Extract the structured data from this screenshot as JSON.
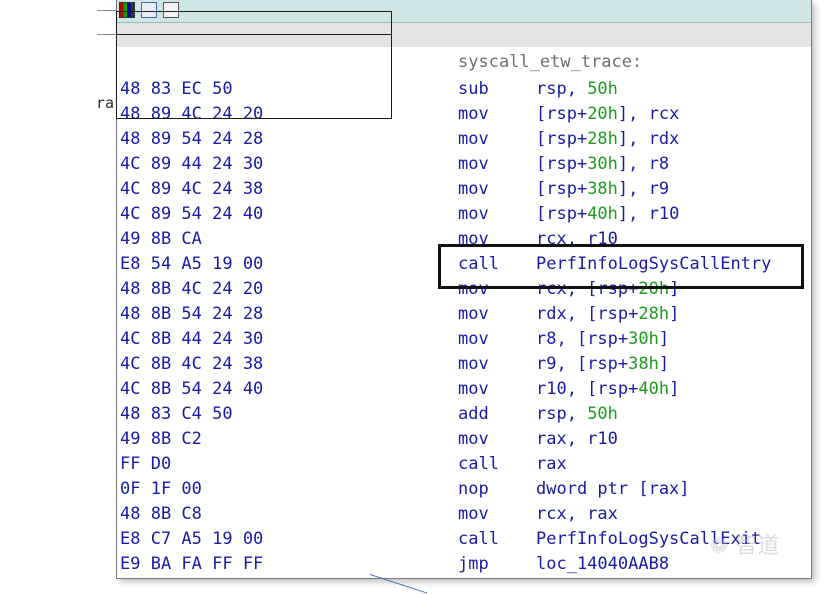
{
  "background": {
    "partial_label": "ra"
  },
  "window": {
    "toolbar_icons": [
      "palette-icon",
      "edit-icon",
      "grid-icon"
    ]
  },
  "disasm": {
    "label": "syscall_etw_trace:",
    "rows": [
      {
        "bytes": "48 83 EC 50",
        "mnem": "sub",
        "ops": [
          [
            "rsp, ",
            ""
          ],
          [
            "50h",
            "num"
          ]
        ]
      },
      {
        "bytes": "48 89 4C 24 20",
        "mnem": "mov",
        "ops": [
          [
            "[rsp+",
            ""
          ],
          [
            "20h",
            "num"
          ],
          [
            "], rcx",
            ""
          ]
        ]
      },
      {
        "bytes": "48 89 54 24 28",
        "mnem": "mov",
        "ops": [
          [
            "[rsp+",
            ""
          ],
          [
            "28h",
            "num"
          ],
          [
            "], rdx",
            ""
          ]
        ]
      },
      {
        "bytes": "4C 89 44 24 30",
        "mnem": "mov",
        "ops": [
          [
            "[rsp+",
            ""
          ],
          [
            "30h",
            "num"
          ],
          [
            "], r8",
            ""
          ]
        ]
      },
      {
        "bytes": "4C 89 4C 24 38",
        "mnem": "mov",
        "ops": [
          [
            "[rsp+",
            ""
          ],
          [
            "38h",
            "num"
          ],
          [
            "], r9",
            ""
          ]
        ]
      },
      {
        "bytes": "4C 89 54 24 40",
        "mnem": "mov",
        "ops": [
          [
            "[rsp+",
            ""
          ],
          [
            "40h",
            "num"
          ],
          [
            "], r10",
            ""
          ]
        ]
      },
      {
        "bytes": "49 8B CA",
        "mnem": "mov",
        "ops": [
          [
            "rcx, r10",
            ""
          ]
        ]
      },
      {
        "bytes": "E8 54 A5 19 00",
        "mnem": "call",
        "ops": [
          [
            "PerfInfoLogSysCallEntry",
            ""
          ]
        ]
      },
      {
        "bytes": "48 8B 4C 24 20",
        "mnem": "mov",
        "ops": [
          [
            "rcx, [rsp+",
            ""
          ],
          [
            "20h",
            "num"
          ],
          [
            "]",
            ""
          ]
        ]
      },
      {
        "bytes": "48 8B 54 24 28",
        "mnem": "mov",
        "ops": [
          [
            "rdx, [rsp+",
            ""
          ],
          [
            "28h",
            "num"
          ],
          [
            "]",
            ""
          ]
        ]
      },
      {
        "bytes": "4C 8B 44 24 30",
        "mnem": "mov",
        "ops": [
          [
            "r8, [rsp+",
            ""
          ],
          [
            "30h",
            "num"
          ],
          [
            "]",
            ""
          ]
        ]
      },
      {
        "bytes": "4C 8B 4C 24 38",
        "mnem": "mov",
        "ops": [
          [
            "r9, [rsp+",
            ""
          ],
          [
            "38h",
            "num"
          ],
          [
            "]",
            ""
          ]
        ]
      },
      {
        "bytes": "4C 8B 54 24 40",
        "mnem": "mov",
        "ops": [
          [
            "r10, [rsp+",
            ""
          ],
          [
            "40h",
            "num"
          ],
          [
            "]",
            ""
          ]
        ]
      },
      {
        "bytes": "48 83 C4 50",
        "mnem": "add",
        "ops": [
          [
            "rsp, ",
            ""
          ],
          [
            "50h",
            "num"
          ]
        ]
      },
      {
        "bytes": "49 8B C2",
        "mnem": "mov",
        "ops": [
          [
            "rax, r10",
            ""
          ]
        ]
      },
      {
        "bytes": "FF D0",
        "mnem": "call",
        "ops": [
          [
            "rax",
            ""
          ]
        ]
      },
      {
        "bytes": "0F 1F 00",
        "mnem": "nop",
        "ops": [
          [
            "dword ptr [rax]",
            ""
          ]
        ]
      },
      {
        "bytes": "48 8B C8",
        "mnem": "mov",
        "ops": [
          [
            "rcx, rax",
            ""
          ]
        ]
      },
      {
        "bytes": "E8 C7 A5 19 00",
        "mnem": "call",
        "ops": [
          [
            "PerfInfoLogSysCallExit",
            ""
          ]
        ]
      },
      {
        "bytes": "E9 BA FA FF FF",
        "mnem": "jmp",
        "ops": [
          [
            "loc_14040AAB8",
            ""
          ]
        ]
      }
    ]
  },
  "watermark": "❁ 智道",
  "colors": {
    "code": "#1a1aa6",
    "number": "#1f9a1f",
    "label": "#6e6e6e",
    "titlebar": "#cfe6e6"
  }
}
